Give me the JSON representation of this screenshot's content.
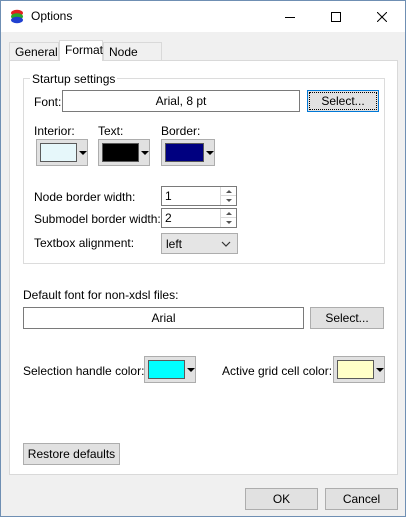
{
  "window": {
    "title": "Options"
  },
  "tabs": [
    "General",
    "Format",
    "Node Grid"
  ],
  "startup": {
    "group_label": "Startup settings",
    "font_label": "Font:",
    "font_value": "Arial, 8 pt",
    "font_select": "Select...",
    "interior_label": "Interior:",
    "text_label": "Text:",
    "border_label": "Border:",
    "interior_color": "#e6f7fa",
    "text_color": "#000000",
    "border_color": "#000080",
    "node_border_label": "Node border width:",
    "node_border_value": "1",
    "submodel_border_label": "Submodel border width:",
    "submodel_border_value": "2",
    "textbox_align_label": "Textbox alignment:",
    "textbox_align_value": "left"
  },
  "default_font": {
    "label": "Default font for non-xdsl files:",
    "value": "Arial",
    "select": "Select..."
  },
  "colors": {
    "selection_label": "Selection handle color:",
    "selection_color": "#00ffff",
    "grid_label": "Active grid cell color:",
    "grid_color": "#ffffc8"
  },
  "restore_defaults": "Restore defaults",
  "ok": "OK",
  "cancel": "Cancel"
}
